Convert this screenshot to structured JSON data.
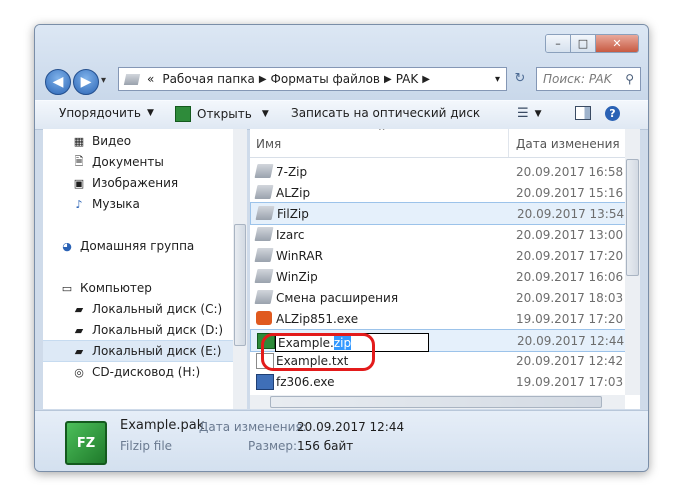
{
  "window": {
    "controls": {
      "minimize": "–",
      "maximize": "□",
      "close": "✕"
    }
  },
  "nav_buttons": {
    "back": "◀",
    "forward": "▶",
    "dropdown": "▾"
  },
  "address": {
    "crumbs": [
      "Рабочая папка",
      "Форматы файлов",
      "PAK"
    ],
    "prefix": "«"
  },
  "search": {
    "placeholder": "Поиск: PAK"
  },
  "toolbar": {
    "organize": "Упорядочить",
    "open": "Открыть",
    "burn": "Записать на оптический диск"
  },
  "sidebar": {
    "items": [
      {
        "label": "Видео",
        "icon": "video-icon"
      },
      {
        "label": "Документы",
        "icon": "documents-icon"
      },
      {
        "label": "Изображения",
        "icon": "images-icon"
      },
      {
        "label": "Музыка",
        "icon": "music-icon"
      },
      {
        "label": "Домашняя группа",
        "icon": "homegroup-icon"
      },
      {
        "label": "Компьютер",
        "icon": "computer-icon"
      },
      {
        "label": "Локальный диск (C:)",
        "icon": "drive-icon"
      },
      {
        "label": "Локальный диск (D:)",
        "icon": "drive-icon"
      },
      {
        "label": "Локальный диск (E:)",
        "icon": "drive-icon"
      },
      {
        "label": "CD-дисковод (H:)",
        "icon": "cd-drive-icon"
      }
    ]
  },
  "columns": {
    "name": "Имя",
    "date": "Дата изменения"
  },
  "files": [
    {
      "name": "7-Zip",
      "date": "20.09.2017 16:58"
    },
    {
      "name": "ALZip",
      "date": "20.09.2017 15:16"
    },
    {
      "name": "FilZip",
      "date": "20.09.2017 13:54"
    },
    {
      "name": "Izarc",
      "date": "20.09.2017 13:00"
    },
    {
      "name": "WinRAR",
      "date": "20.09.2017 17:20"
    },
    {
      "name": "WinZip",
      "date": "20.09.2017 16:06"
    },
    {
      "name": "Смена расширения",
      "date": "20.09.2017 18:03"
    },
    {
      "name": "ALZip851.exe",
      "date": "19.09.2017 17:20"
    },
    {
      "name": "Example.zip",
      "date": "20.09.2017 12:44"
    },
    {
      "name": "Example.txt",
      "date": "20.09.2017 12:42"
    },
    {
      "name": "fz306.exe",
      "date": "19.09.2017 17:03"
    }
  ],
  "rename": {
    "base": "Example.",
    "ext": "zip"
  },
  "status": {
    "filename": "Example.pak",
    "type": "Filzip file",
    "modified_label": "Дата изменения:",
    "modified_value": "20.09.2017 12:44",
    "size_label": "Размер:",
    "size_value": "156 байт"
  },
  "colors": {
    "accent": "#3399ff",
    "highlight_oval": "#e31b1b"
  }
}
